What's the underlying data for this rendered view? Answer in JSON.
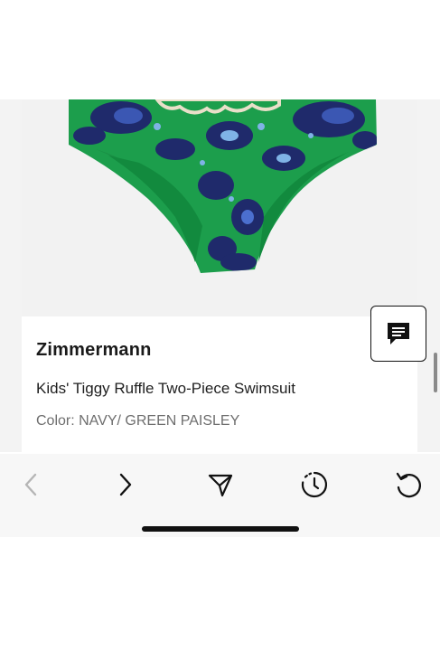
{
  "product": {
    "brand": "Zimmermann",
    "title": "Kids' Tiggy Ruffle Two-Piece Swimsuit",
    "color_line": "Color: NAVY/ GREEN PAISLEY"
  },
  "icons": {
    "chat": "chat-bubble-icon",
    "back": "chevron-left-icon",
    "forward": "chevron-right-icon",
    "share": "send-icon",
    "history": "timer-icon",
    "reload": "reload-icon"
  },
  "colors": {
    "swim_green": "#1c9e4c",
    "swim_navy": "#1f2a6b",
    "ruffle_cream": "#e9dfc9",
    "toolbar_bg": "#f7f7f7"
  }
}
